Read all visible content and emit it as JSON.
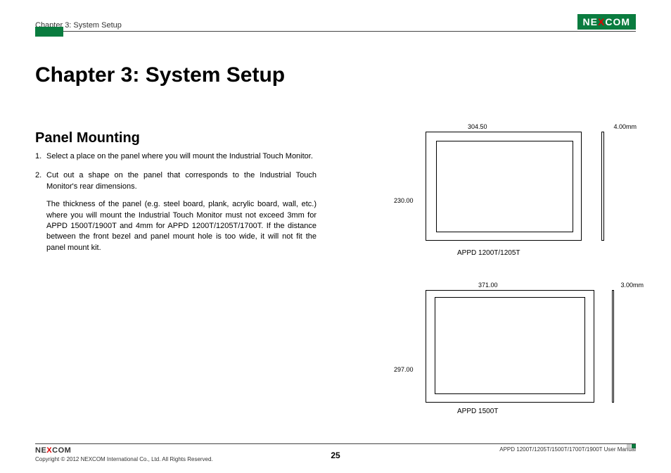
{
  "header": {
    "breadcrumb": "Chapter 3: System Setup",
    "logo_pre": "NE",
    "logo_x": "X",
    "logo_post": "COM"
  },
  "chapter_title": "Chapter 3: System Setup",
  "section_title": "Panel Mounting",
  "steps": [
    "Select a place on the panel where you will mount the Industrial Touch Monitor.",
    "Cut out a shape on the panel that corresponds to the Industrial Touch Monitor's rear dimensions."
  ],
  "note": "The thickness of the panel (e.g. steel board, plank, acrylic board, wall, etc.) where you will mount the Industrial Touch Monitor must not exceed 3mm for APPD 1500T/1900T and 4mm for APPD 1200T/1205T/1700T. If the distance between the front bezel and panel mount hole is too wide, it will not fit the panel mount kit.",
  "diagrams": [
    {
      "width": "304.50",
      "thickness": "4.00mm",
      "height": "230.00",
      "caption": "APPD 1200T/1205T"
    },
    {
      "width": "371.00",
      "thickness": "3.00mm",
      "height": "297.00",
      "caption": "APPD 1500T"
    }
  ],
  "footer": {
    "logo_pre": "NE",
    "logo_x": "X",
    "logo_post": "COM",
    "copyright": "Copyright © 2012 NEXCOM International Co., Ltd. All Rights Reserved.",
    "page": "25",
    "manual": "APPD 1200T/1205T/1500T/1700T/1900T User Manual"
  }
}
